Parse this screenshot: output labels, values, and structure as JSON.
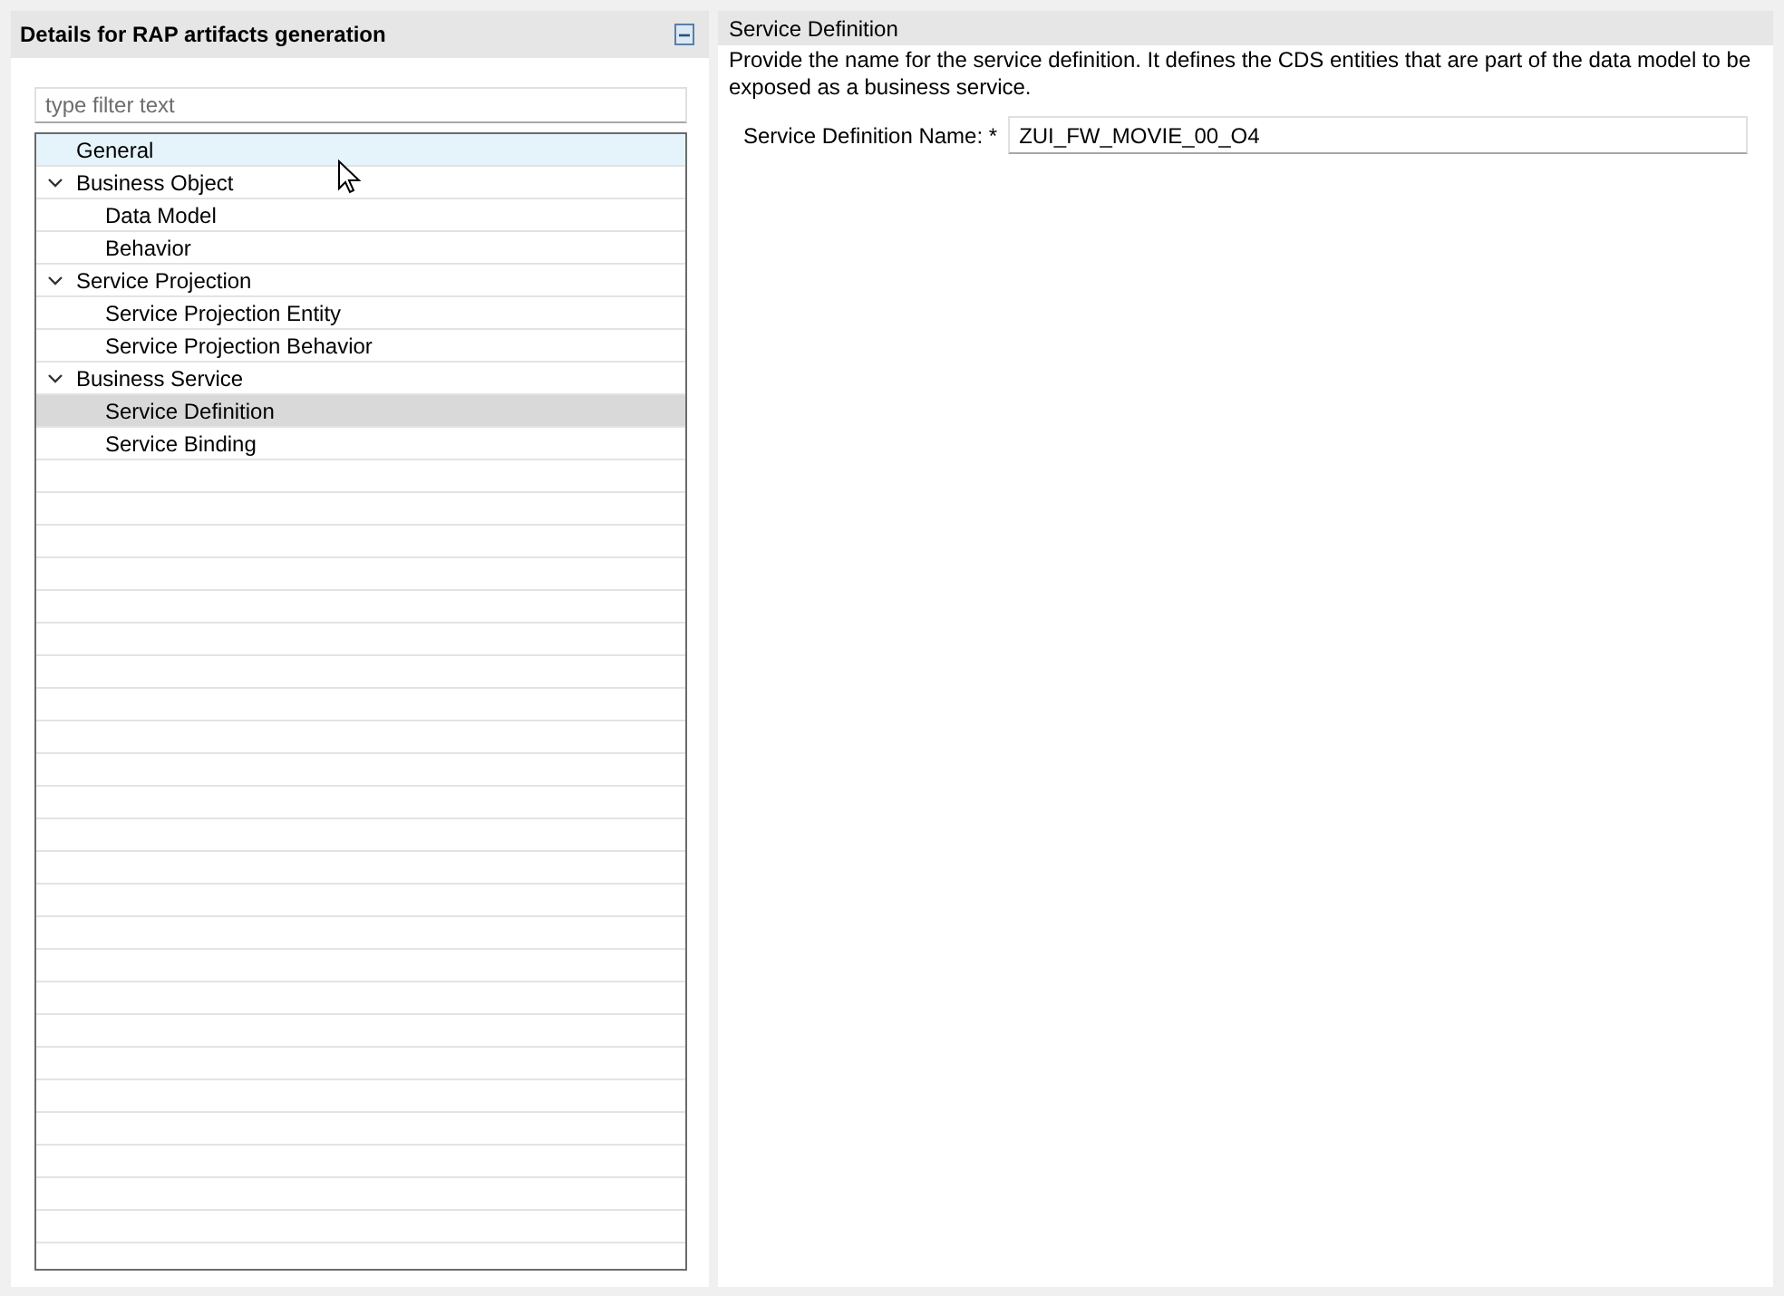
{
  "left_panel": {
    "title": "Details for RAP artifacts generation",
    "filter": {
      "placeholder": "type filter text"
    },
    "tree": [
      {
        "label": "General",
        "selected": false,
        "hovered": true
      },
      {
        "label": "Business Object",
        "selected": false,
        "hovered": false,
        "expanded": true,
        "children": [
          {
            "label": "Data Model",
            "selected": false,
            "hovered": false
          },
          {
            "label": "Behavior",
            "selected": false,
            "hovered": false
          }
        ]
      },
      {
        "label": "Service Projection",
        "selected": false,
        "hovered": false,
        "expanded": true,
        "children": [
          {
            "label": "Service Projection Entity",
            "selected": false,
            "hovered": false
          },
          {
            "label": "Service Projection Behavior",
            "selected": false,
            "hovered": false
          }
        ]
      },
      {
        "label": "Business Service",
        "selected": false,
        "hovered": false,
        "expanded": true,
        "children": [
          {
            "label": "Service Definition",
            "selected": true,
            "hovered": false
          },
          {
            "label": "Service Binding",
            "selected": false,
            "hovered": false
          }
        ]
      }
    ]
  },
  "right_panel": {
    "title": "Service Definition",
    "description": "Provide the name for the service definition. It defines the CDS entities that are part of the data model to be exposed as a business service.",
    "field": {
      "label": "Service Definition Name: *",
      "value": "ZUI_FW_MOVIE_00_O4"
    }
  }
}
